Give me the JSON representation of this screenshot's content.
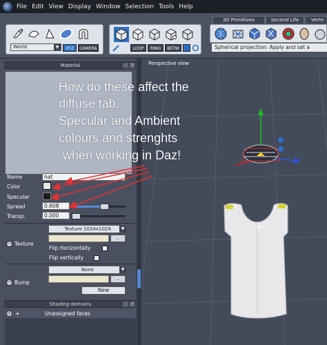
{
  "menubar": {
    "items": [
      "File",
      "Edit",
      "View",
      "Display",
      "Window",
      "Selection",
      "Tools",
      "Help"
    ]
  },
  "toolbar": {
    "coordinate_space": "World",
    "xyz_label": "XYZ",
    "camera_label": "CAMERA",
    "loop_label": "LOOP",
    "ring_label": "RING",
    "betw_label": "BETW",
    "tabs": [
      "3D Primitives",
      "Second Life",
      "Verte"
    ],
    "projection_label": "Spherical projection: Apply and set a"
  },
  "material_panel": {
    "title": "Material",
    "name_label": "Name",
    "name_value": "hat",
    "color_label": "Color",
    "specular_label": "Specular",
    "spread_label": "Spread",
    "spread_value": "0.608",
    "spread_fraction": 0.608,
    "transp_label": "Transp.",
    "transp_value": "0.000",
    "transp_fraction": 0.0,
    "texture_label": "Texture",
    "texture_size": "Texture 1024x1024",
    "dots": "...",
    "flip_h": "Flip Horizontally",
    "flip_v": "Flip vertically",
    "bump_label": "Bump",
    "bump_value": "None",
    "new_button": "New",
    "colors": {
      "color_swatch": "#e8e8e8",
      "specular_swatch": "#1b1b1b"
    }
  },
  "shading_panel": {
    "title": "Shading domains",
    "item": "Unassigned faces"
  },
  "viewport": {
    "title": "Perspective view"
  },
  "annotation": {
    "lines": [
      "How do these affect the",
      "diffuse tab,",
      "Specular and Ambient",
      "colours and strenghts",
      "when working in Daz!"
    ]
  }
}
